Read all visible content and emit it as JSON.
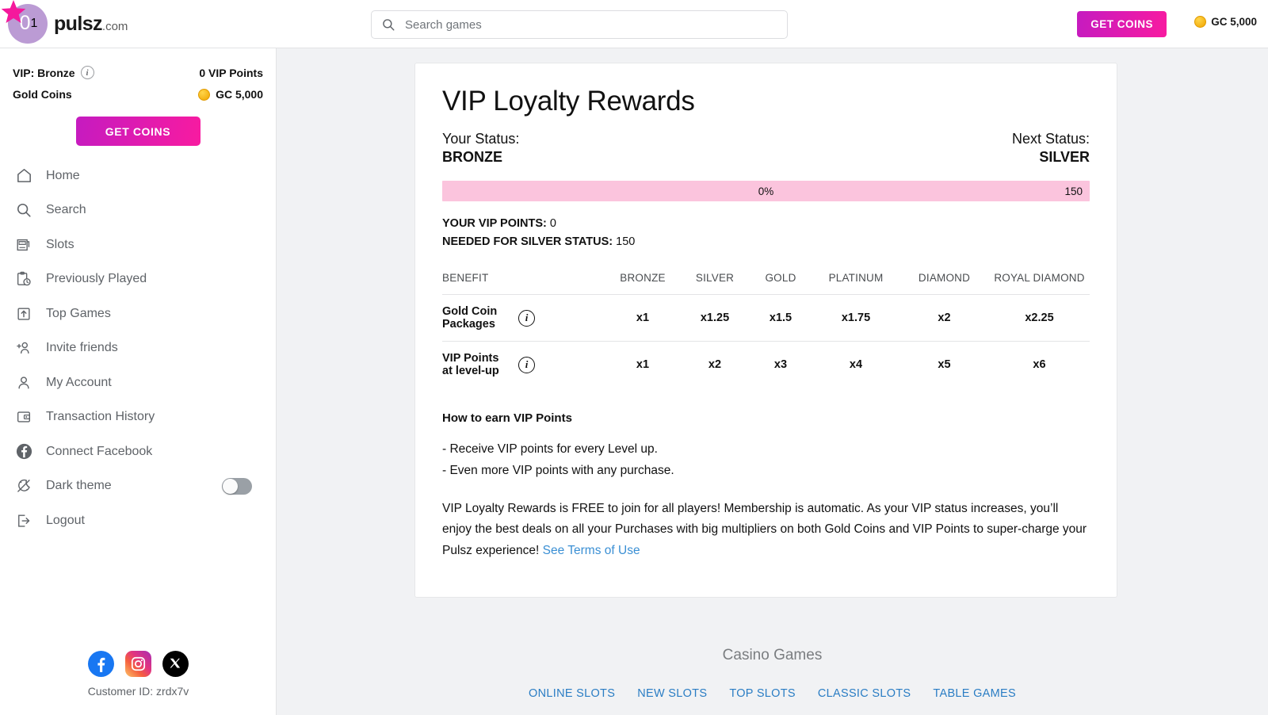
{
  "header": {
    "logo": {
      "brand": "pulsz",
      "suffix": ".com",
      "star_number": "1",
      "circle_char": "0"
    },
    "search": {
      "placeholder": "Search games",
      "value": "",
      "icon": "search-icon"
    },
    "get_coins_label": "GET COINS",
    "balance": {
      "icon": "gold-coin-icon",
      "text": "GC 5,000"
    }
  },
  "sidebar": {
    "vip": {
      "label": "VIP: Bronze",
      "info_icon": "info-icon",
      "points": "0 VIP Points"
    },
    "gold_coins": {
      "label": "Gold Coins",
      "icon": "gold-coin-icon",
      "value": "GC 5,000"
    },
    "get_coins_label": "GET COINS",
    "items": [
      {
        "label": "Home",
        "icon": "home-icon"
      },
      {
        "label": "Search",
        "icon": "search-icon"
      },
      {
        "label": "Slots",
        "icon": "slot-machine-icon"
      },
      {
        "label": "Previously Played",
        "icon": "clipboard-clock-icon"
      },
      {
        "label": "Top Games",
        "icon": "upload-box-icon"
      },
      {
        "label": "Invite friends",
        "icon": "add-person-icon"
      },
      {
        "label": "My Account",
        "icon": "person-icon"
      },
      {
        "label": "Transaction History",
        "icon": "wallet-icon"
      },
      {
        "label": "Connect Facebook",
        "icon": "facebook-icon"
      },
      {
        "label": "Dark theme",
        "icon": "moon-stars-icon",
        "toggle": "off"
      },
      {
        "label": "Logout",
        "icon": "logout-arrow-icon"
      }
    ],
    "socials": [
      {
        "name": "facebook-icon"
      },
      {
        "name": "instagram-icon"
      },
      {
        "name": "x-twitter-icon"
      }
    ],
    "customer_id": "Customer ID: zrdx7v"
  },
  "main": {
    "title": "VIP Loyalty Rewards",
    "your_status_label": "Your Status:",
    "your_status_value": "BRONZE",
    "next_status_label": "Next Status:",
    "next_status_value": "SILVER",
    "progress": {
      "percent_label": "0%",
      "goal_label": "150",
      "percent_value": 0,
      "bar_color": "#fbc4dd"
    },
    "points": {
      "your_points_label": "YOUR VIP POINTS:",
      "your_points_value": "0",
      "needed_label": "NEEDED FOR SILVER STATUS:",
      "needed_value": "150"
    },
    "table": {
      "columns": [
        "BENEFIT",
        "BRONZE",
        "SILVER",
        "GOLD",
        "PLATINUM",
        "DIAMOND",
        "ROYAL DIAMOND"
      ],
      "rows": [
        {
          "benefit": "Gold Coin Packages",
          "info_icon": "info-icon",
          "values": [
            "x1",
            "x1.25",
            "x1.5",
            "x1.75",
            "x2",
            "x2.25"
          ]
        },
        {
          "benefit": "VIP Points at level-up",
          "info_icon": "info-icon",
          "values": [
            "x1",
            "x2",
            "x3",
            "x4",
            "x5",
            "x6"
          ]
        }
      ]
    },
    "howto_heading": "How to earn VIP Points",
    "bullets": [
      "- Receive VIP points for every Level up.",
      "- Even more VIP points with any purchase."
    ],
    "paragraph": "VIP Loyalty Rewards is FREE to join for all players! Membership is automatic. As your VIP status increases, you’ll enjoy the best deals on all your Purchases with big multipliers on both Gold Coins and VIP Points to super-charge your Pulsz experience!",
    "terms_link": "See Terms of Use"
  },
  "footer": {
    "casino_title": "Casino Games",
    "links": [
      "ONLINE SLOTS",
      "NEW SLOTS",
      "TOP SLOTS",
      "CLASSIC SLOTS",
      "TABLE GAMES"
    ]
  },
  "colors": {
    "brand_pink": "#e6199a",
    "cta_gradient_start": "#c51bc0",
    "cta_gradient_end": "#f81ba0",
    "progress_pink": "#fbc4dd",
    "link_blue": "#3a8fd4",
    "page_bg": "#f1f2f4"
  }
}
